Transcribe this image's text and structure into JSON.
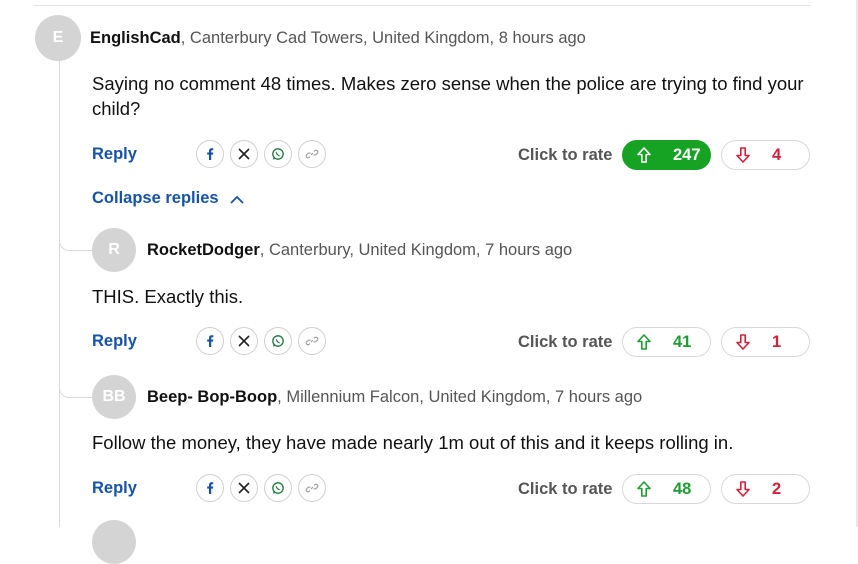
{
  "comments": [
    {
      "avatar": "E",
      "username": "EnglishCad",
      "location": ", Canterbury Cad Towers, United Kingdom, 8 hours ago",
      "body": "Saying no comment 48 times. Makes zero sense when the police are trying to find your child?",
      "reply": "Reply",
      "rate_label": "Click to rate",
      "upvotes": "247",
      "downvotes": "4"
    },
    {
      "avatar": "R",
      "username": "RocketDodger",
      "location": ", Canterbury, United Kingdom, 7 hours ago",
      "body": "THIS. Exactly this.",
      "reply": "Reply",
      "rate_label": "Click to rate",
      "upvotes": "41",
      "downvotes": "1"
    },
    {
      "avatar": "BB",
      "username": "Beep- Bop-Boop",
      "location": ", Millennium Falcon, United Kingdom, 7 hours ago",
      "body": "Follow the money, they have made nearly 1m out of this and it keeps rolling in.",
      "reply": "Reply",
      "rate_label": "Click to rate",
      "upvotes": "48",
      "downvotes": "2"
    }
  ],
  "collapse_replies": "Collapse replies",
  "share_icons": [
    "facebook-icon",
    "x-icon",
    "whatsapp-icon",
    "link-icon"
  ],
  "colors": {
    "link_blue": "#1653a6",
    "upvote_green": "#16a323",
    "downvote_red": "#d4203a",
    "avatar_grey": "#d4d4d4"
  }
}
